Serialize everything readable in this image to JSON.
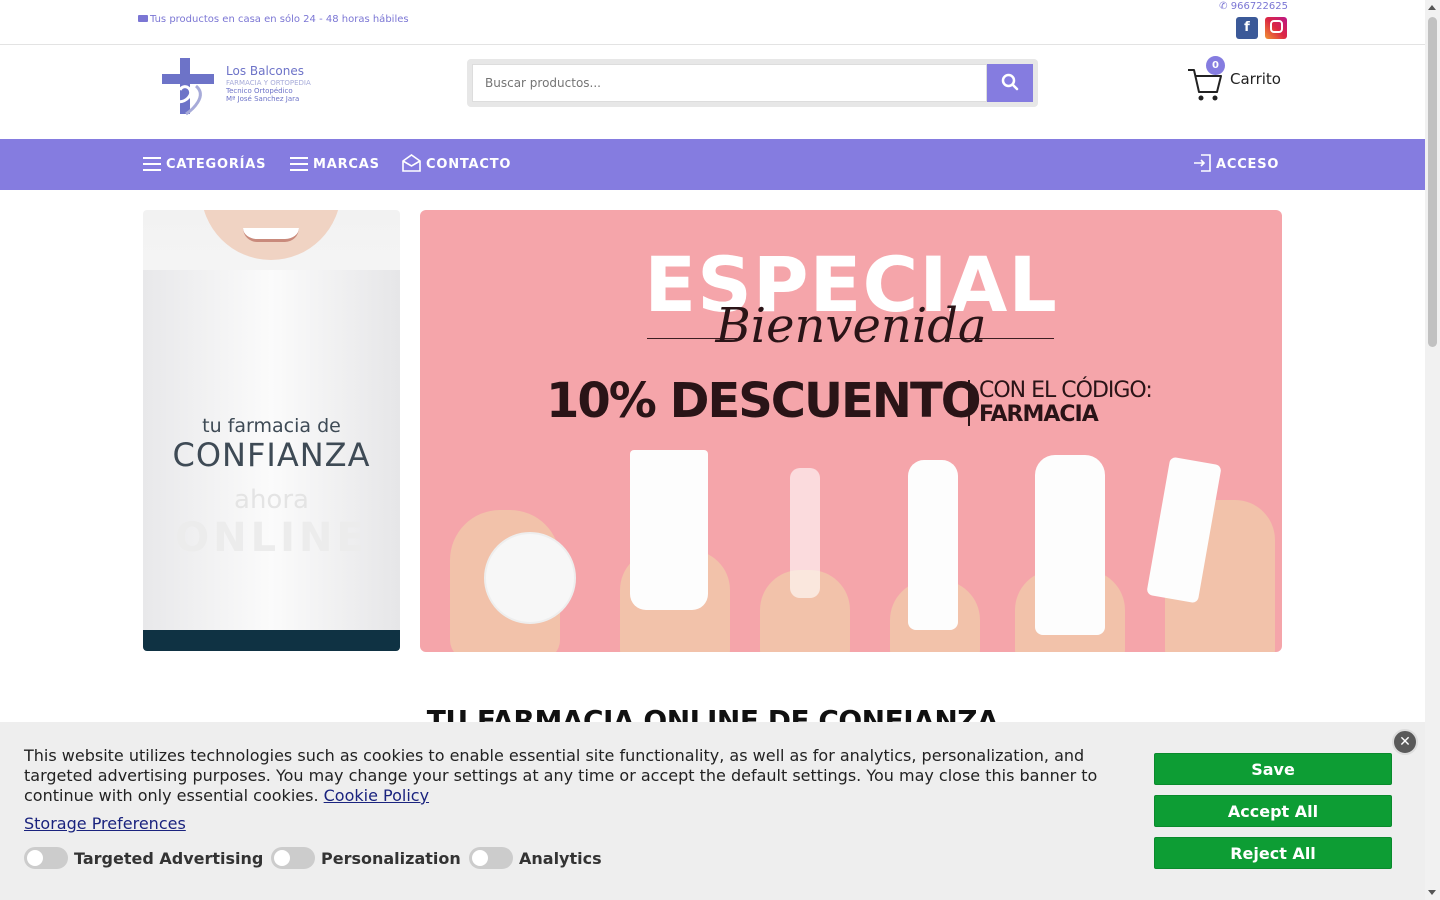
{
  "topbar": {
    "shipping_text": "Tus productos en casa en sólo 24 - 48 horas hábiles",
    "phone": "966722625",
    "social": [
      "facebook-icon",
      "instagram-icon"
    ]
  },
  "header": {
    "logo": {
      "name": "Los Balcones",
      "subtitle": "FARMACIA Y ORTOPEDIA",
      "line3": "Tecnico Ortopédico",
      "line4": "Mª José Sanchez Jara"
    },
    "search": {
      "placeholder": "Buscar productos..."
    },
    "cart": {
      "count": "0",
      "label": "Carrito"
    }
  },
  "nav": {
    "items": [
      {
        "label": "CATEGORÍAS",
        "icon": "menu-icon"
      },
      {
        "label": "MARCAS",
        "icon": "menu-icon"
      },
      {
        "label": "CONTACTO",
        "icon": "envelope-icon"
      }
    ],
    "login": {
      "label": "ACCESO",
      "icon": "login-icon"
    }
  },
  "banner_left": {
    "line1": "tu farmacia de",
    "line2": "CONFIANZA",
    "line3": "ahora",
    "line4": "ONLINE"
  },
  "banner_main": {
    "title": "ESPECIAL",
    "script": "Bienvenida",
    "discount": "10% DESCUENTO",
    "code_label": "CON EL CÓDIGO:",
    "code": "FARMACIA"
  },
  "main": {
    "headline": "TU FARMACIA ONLINE DE CONFIANZA"
  },
  "cookie_banner": {
    "message": "This website utilizes technologies such as cookies to enable essential site functionality, as well as for analytics, personalization, and targeted advertising purposes. You may change your settings at any time or accept the default settings. You may close this banner to continue with only essential cookies.",
    "policy_link": "Cookie Policy",
    "preferences_link": "Storage Preferences",
    "toggles": [
      "Targeted Advertising",
      "Personalization",
      "Analytics"
    ],
    "buttons": {
      "save": "Save",
      "accept": "Accept All",
      "reject": "Reject All"
    },
    "close_label": "✕"
  },
  "colors": {
    "brand": "#857ce0",
    "cookie_button": "#0d9d34",
    "banner_pink": "#f5a5aa"
  }
}
